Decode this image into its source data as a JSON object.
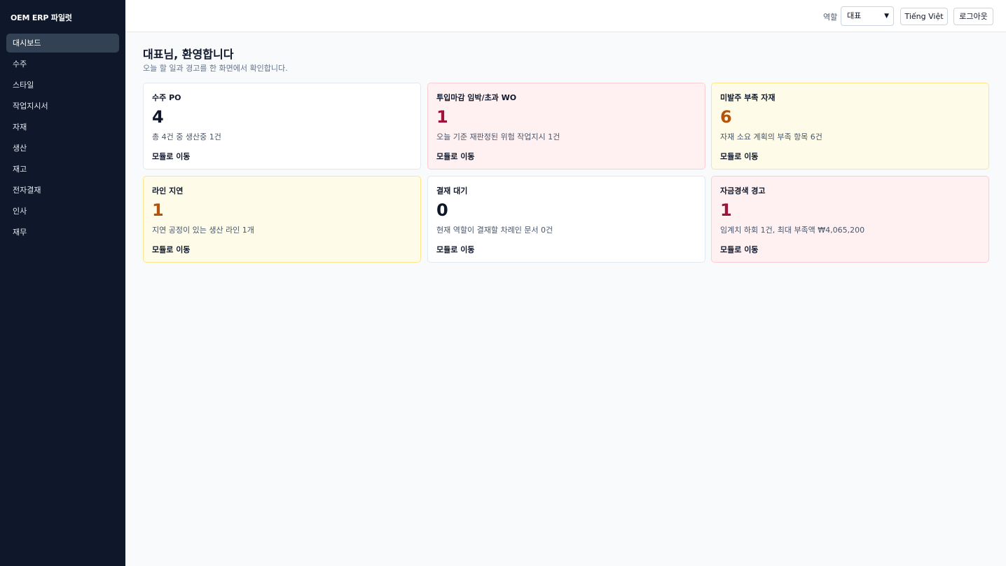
{
  "app": {
    "title": "OEM ERP 파일럿"
  },
  "sidebar": {
    "items": [
      {
        "label": "대시보드",
        "active": true
      },
      {
        "label": "수주"
      },
      {
        "label": "스타일"
      },
      {
        "label": "작업지시서"
      },
      {
        "label": "자재"
      },
      {
        "label": "생산"
      },
      {
        "label": "재고"
      },
      {
        "label": "전자결재"
      },
      {
        "label": "인사"
      },
      {
        "label": "재무"
      }
    ]
  },
  "topbar": {
    "role_label": "역할",
    "role_value": "대표",
    "lang_button": "Tiếng Việt",
    "logout_button": "로그아웃"
  },
  "page": {
    "title": "대표님, 환영합니다",
    "subtitle": "오늘 할 일과 경고를 한 화면에서 확인합니다."
  },
  "cards": [
    {
      "title": "수주 PO",
      "value": "4",
      "desc": "총 4건 중 생산중 1건",
      "link": "모듈로 이동",
      "tone": "default",
      "value_color": "#0f172a"
    },
    {
      "title": "투입마감 임박/초과 WO",
      "value": "1",
      "desc": "오늘 기준 재판정된 위험 작업지시 1건",
      "link": "모듈로 이동",
      "tone": "red",
      "value_color": "#9f1239"
    },
    {
      "title": "미발주 부족 자재",
      "value": "6",
      "desc": "자재 소요 계획의 부족 항목 6건",
      "link": "모듈로 이동",
      "tone": "yellow",
      "value_color": "#b45309"
    },
    {
      "title": "라인 지연",
      "value": "1",
      "desc": "지연 공정이 있는 생산 라인 1개",
      "link": "모듈로 이동",
      "tone": "yellow",
      "value_color": "#b45309"
    },
    {
      "title": "결재 대기",
      "value": "0",
      "desc": "현재 역할이 결재할 차례인 문서 0건",
      "link": "모듈로 이동",
      "tone": "default",
      "value_color": "#0f172a"
    },
    {
      "title": "자금경색 경고",
      "value": "1",
      "desc": "임계치 하회 1건, 최대 부족액 ₩4,065,200",
      "link": "모듈로 이동",
      "tone": "red",
      "value_color": "#9f1239"
    }
  ]
}
